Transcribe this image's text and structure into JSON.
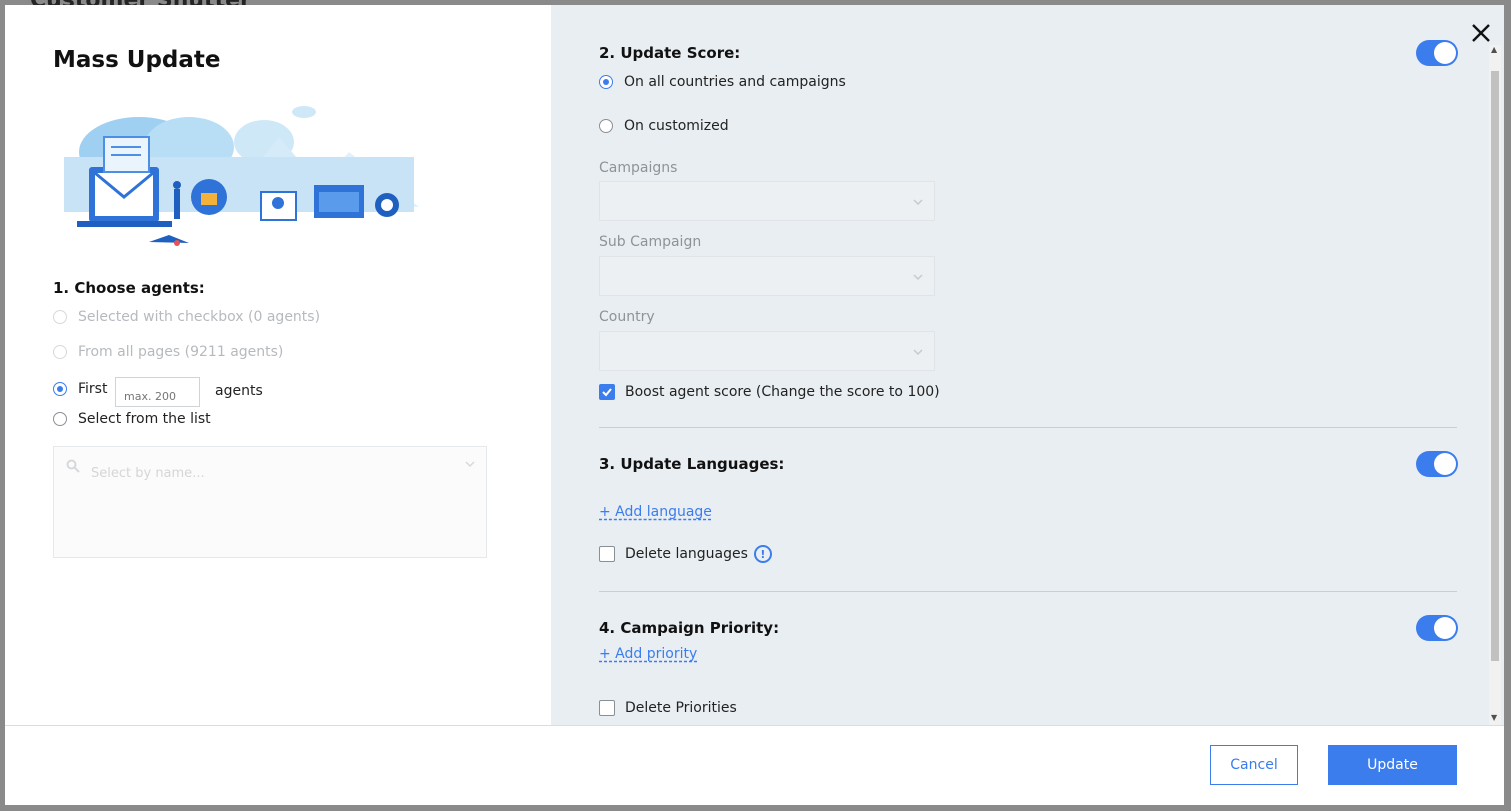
{
  "background": {
    "title": "Customer Shutter"
  },
  "modal": {
    "title": "Mass Update",
    "section1": {
      "title": "1. Choose agents:",
      "options": [
        "Selected with checkbox (0 agents)",
        "From all pages (9211 agents)",
        "First",
        "Select from the list"
      ],
      "selected": "First",
      "first_input_placeholder": "max. 200",
      "first_suffix": "agents",
      "select_placeholder": "Select by name..."
    },
    "section2": {
      "title": "2. Update Score:",
      "enabled": true,
      "options": [
        "On all countries and campaigns",
        "On customized"
      ],
      "selected": "On all countries and campaigns",
      "fields": [
        "Campaigns",
        "Sub Campaign",
        "Country"
      ],
      "boost_label": "Boost agent score (Change the score to 100)",
      "boost_checked": true
    },
    "section3": {
      "title": "3. Update Languages:",
      "enabled": true,
      "add_link": "+ Add language",
      "delete_label": "Delete languages",
      "info_glyph": "!"
    },
    "section4": {
      "title": "4. Campaign Priority:",
      "enabled": true,
      "add_link": "+ Add priority",
      "delete_label": "Delete Priorities"
    },
    "footer": {
      "cancel": "Cancel",
      "update": "Update"
    }
  },
  "icons": {
    "close": "close-icon",
    "search": "search-icon",
    "chevron": "chevron-down-icon",
    "info": "info-icon",
    "check": "check-icon"
  },
  "colors": {
    "accent": "#3b7ded",
    "right_panel_bg": "#e9eef2"
  }
}
